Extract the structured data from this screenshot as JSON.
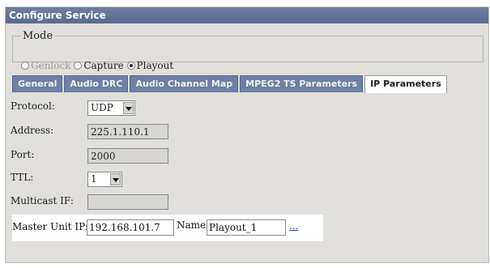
{
  "window": {
    "title": "Configure Service"
  },
  "mode": {
    "legend": "Mode",
    "options": [
      {
        "label": "Genlock",
        "selected": false,
        "disabled": true
      },
      {
        "label": "Capture",
        "selected": false,
        "disabled": false
      },
      {
        "label": "Playout",
        "selected": true,
        "disabled": false
      }
    ]
  },
  "tabs": [
    {
      "label": "General",
      "active": false
    },
    {
      "label": "Audio DRC",
      "active": false
    },
    {
      "label": "Audio Channel Map",
      "active": false
    },
    {
      "label": "MPEG2 TS Parameters",
      "active": false
    },
    {
      "label": "IP Parameters",
      "active": true
    }
  ],
  "fields": {
    "protocol": {
      "label": "Protocol:",
      "value": "UDP"
    },
    "address": {
      "label": "Address:",
      "value": "225.1.110.1"
    },
    "port": {
      "label": "Port:",
      "value": "2000"
    },
    "ttl": {
      "label": "TTL:",
      "value": "1"
    },
    "multicast_if": {
      "label": "Multicast IF:",
      "value": ""
    }
  },
  "master": {
    "label": "Master Unit IP:",
    "ip": "192.168.101.7",
    "name_label": "Name:",
    "name": "Playout_1",
    "more": "..."
  },
  "colors": {
    "tab_bg": "#6f7fa4",
    "title_bg": "#5f6f96",
    "panel_bg": "#e0dfdb"
  }
}
